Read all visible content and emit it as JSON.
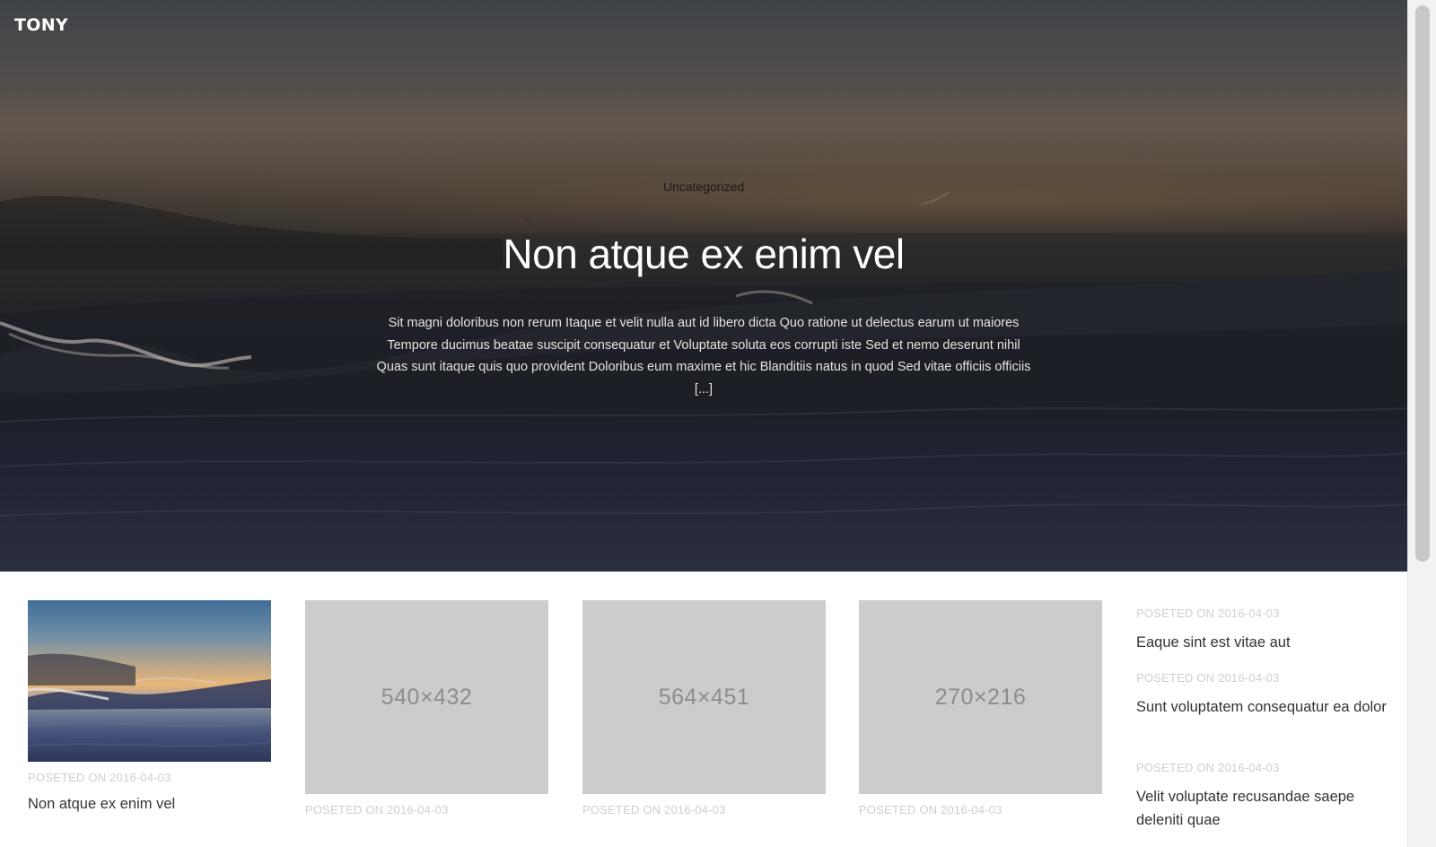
{
  "site": {
    "brand": "TONY"
  },
  "hero": {
    "category": "Uncategorized",
    "title": "Non atque ex enim vel",
    "excerpt": "Sit magni doloribus non rerum Itaque et velit nulla aut id libero dicta Quo ratione ut delectus earum ut maiores Tempore ducimus beatae suscipit consequatur et Voluptate soluta eos corrupti iste Sed et nemo deserunt nihil Quas sunt itaque quis quo provident Doloribus eum maxime et hic Blanditiis natus in quod Sed vitae officiis officiis [...]"
  },
  "posts": [
    {
      "thumb_label": "",
      "meta": "POSETED ON 2016-04-03",
      "title": "Non atque ex enim vel"
    },
    {
      "thumb_label": "540×432",
      "meta": "POSETED ON 2016-04-03",
      "title": ""
    },
    {
      "thumb_label": "564×451",
      "meta": "POSETED ON 2016-04-03",
      "title": ""
    },
    {
      "thumb_label": "270×216",
      "meta": "POSETED ON 2016-04-03",
      "title": ""
    }
  ],
  "side_posts": [
    {
      "meta": "POSETED ON 2016-04-03",
      "title": "Eaque sint est vitae aut"
    },
    {
      "meta": "POSETED ON 2016-04-03",
      "title": "Sunt voluptatem consequatur ea dolor"
    },
    {
      "meta": "POSETED ON 2016-04-03",
      "title": "Velit voluptate recusandae saepe deleniti quae"
    }
  ]
}
